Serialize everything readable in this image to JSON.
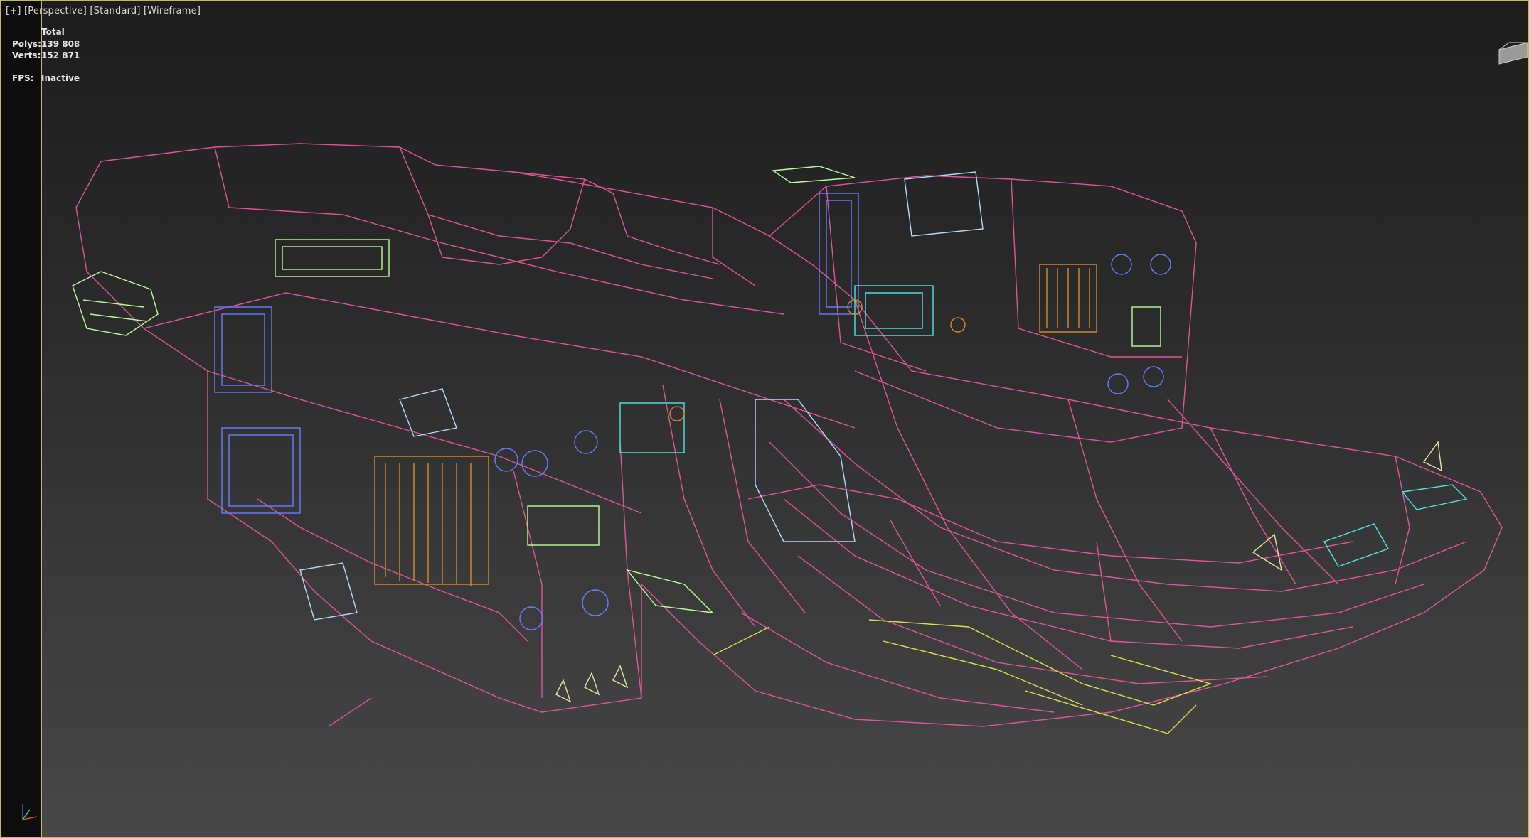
{
  "viewport": {
    "label_plus": "[+]",
    "label_view": "[Perspective]",
    "label_shading_std": "[Standard]",
    "label_shading": "[Wireframe]"
  },
  "stats": {
    "header": "Total",
    "polys_label": "Polys:",
    "polys_value": "139 808",
    "verts_label": "Verts:",
    "verts_value": "152 871",
    "fps_label": "FPS:",
    "fps_value": "Inactive"
  },
  "colors": {
    "frame_border": "#c8b85a",
    "hull_wire": "#e0559a",
    "green_wire": "#b8ff9a",
    "blue_wire": "#6a7cff",
    "cyan_wire": "#4fe6e6",
    "orange_wire": "#d98a2a",
    "yellow_wire": "#d8e04a",
    "lightblue_wire": "#b8d8ff"
  },
  "icons": {
    "viewcube": "viewcube-icon",
    "axis": "axis-tripod-icon"
  }
}
